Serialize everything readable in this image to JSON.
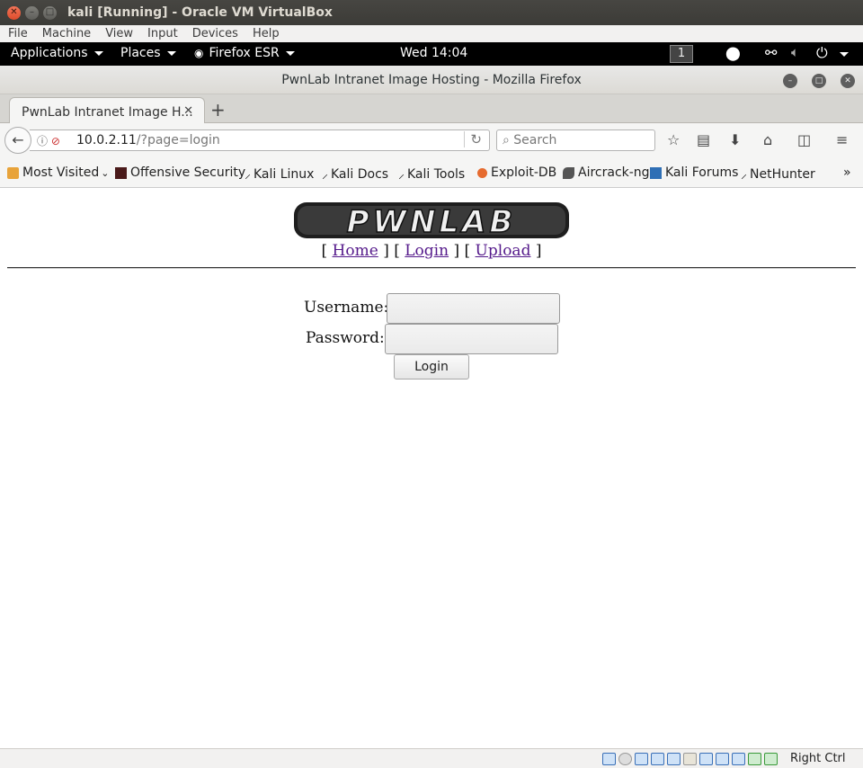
{
  "host_window": {
    "title": "kali [Running] - Oracle VM VirtualBox"
  },
  "vbox_menu": {
    "items": [
      "File",
      "Machine",
      "View",
      "Input",
      "Devices",
      "Help"
    ]
  },
  "kali_panel": {
    "applications": "Applications",
    "places": "Places",
    "firefox": "Firefox ESR",
    "clock": "Wed 14:04",
    "workspace": "1"
  },
  "firefox": {
    "window_title": "PwnLab Intranet Image Hosting - Mozilla Firefox",
    "tab_label": "PwnLab Intranet Image H...",
    "url_host": "10.0.2.11",
    "url_path": "/?page=login",
    "search_placeholder": "Search",
    "bookmarks": [
      {
        "label": "Most Visited",
        "icon": "folder-icon"
      },
      {
        "label": "Offensive Security",
        "icon": "offsec-icon"
      },
      {
        "label": "Kali Linux",
        "icon": "kali-dragon-icon"
      },
      {
        "label": "Kali Docs",
        "icon": "kali-dragon-icon"
      },
      {
        "label": "Kali Tools",
        "icon": "kali-dragon-icon"
      },
      {
        "label": "Exploit-DB",
        "icon": "exploitdb-icon"
      },
      {
        "label": "Aircrack-ng",
        "icon": "aircrack-icon"
      },
      {
        "label": "Kali Forums",
        "icon": "kali-forums-icon"
      },
      {
        "label": "NetHunter",
        "icon": "kali-dragon-icon"
      }
    ]
  },
  "page": {
    "logo_text": "PWNLAB",
    "nav": {
      "open": "[",
      "home": "Home",
      "sep1": "] [",
      "login": "Login",
      "sep2": "] [",
      "upload": "Upload",
      "close": "]"
    },
    "form": {
      "username_label": "Username:",
      "username_value": "",
      "password_label": "Password:",
      "password_value": "",
      "submit_label": "Login"
    }
  },
  "statusbar": {
    "host_key": "Right Ctrl"
  },
  "colors": {
    "link_visited": "#551a8b",
    "panel_bg": "#000000",
    "close_button": "#de4c2b"
  }
}
